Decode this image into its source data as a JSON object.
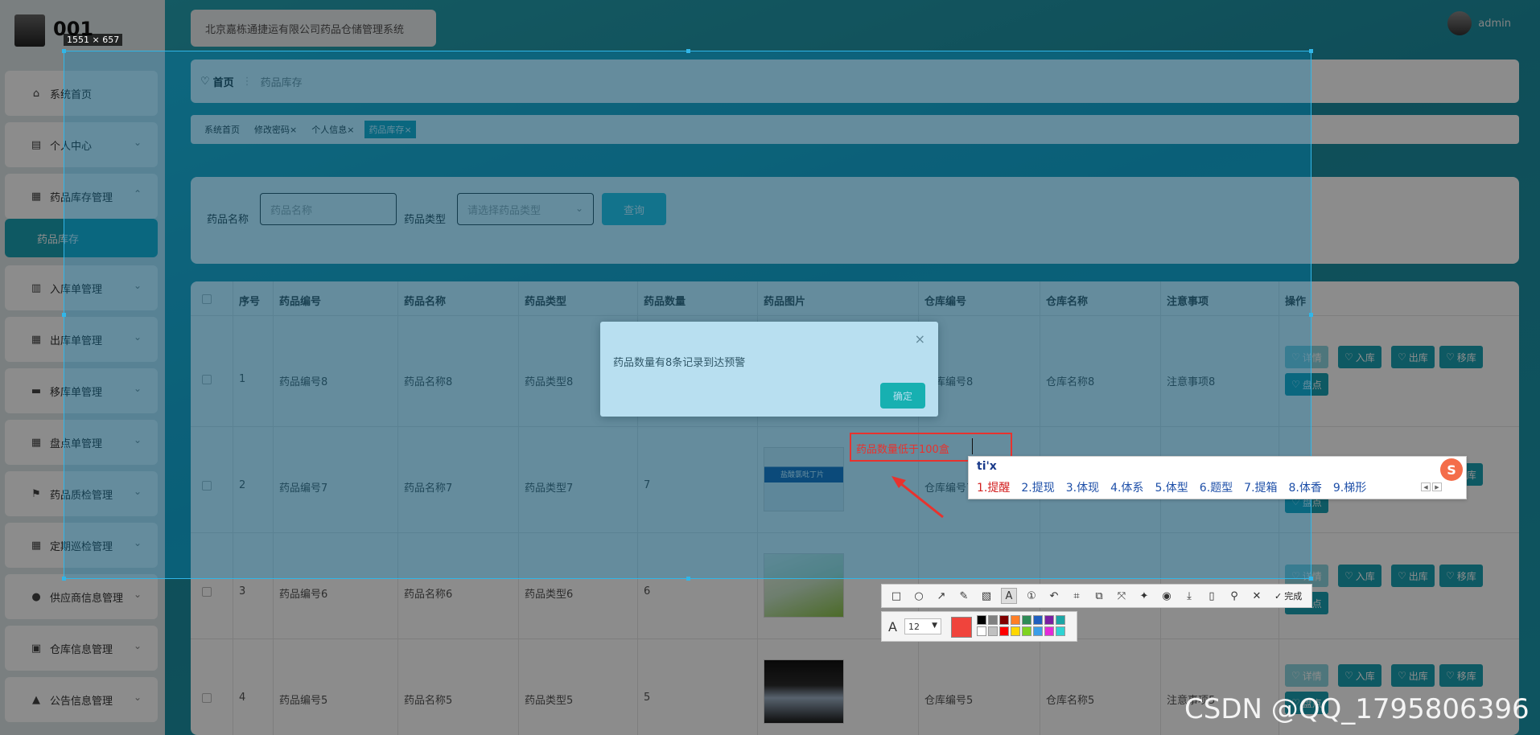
{
  "app": {
    "user_name": "001",
    "system_title": "北京嘉栋通捷运有限公司药品仓储管理系统",
    "top_user_name": "admin"
  },
  "sidebar": {
    "items": [
      {
        "label": "系统首页",
        "icon": "home-icon",
        "glyph": "⌂",
        "chevron": ""
      },
      {
        "label": "个人中心",
        "icon": "calendar-icon",
        "glyph": "▤",
        "chevron": "⌄"
      },
      {
        "label": "药品库存管理",
        "icon": "grid-icon",
        "glyph": "▦",
        "chevron": "⌃"
      },
      {
        "label": "入库单管理",
        "icon": "bar-chart-icon",
        "glyph": "▥",
        "chevron": "⌄"
      },
      {
        "label": "出库单管理",
        "icon": "grid-icon",
        "glyph": "▦",
        "chevron": "⌄"
      },
      {
        "label": "移库单管理",
        "icon": "briefcase-icon",
        "glyph": "▬",
        "chevron": "⌄"
      },
      {
        "label": "盘点单管理",
        "icon": "grid-icon",
        "glyph": "▦",
        "chevron": "⌄"
      },
      {
        "label": "药品质检管理",
        "icon": "flag-icon",
        "glyph": "⚑",
        "chevron": "⌄"
      },
      {
        "label": "定期巡检管理",
        "icon": "grid-icon",
        "glyph": "▦",
        "chevron": "⌄"
      },
      {
        "label": "供应商信息管理",
        "icon": "user-icon",
        "glyph": "●",
        "chevron": "⌄"
      },
      {
        "label": "仓库信息管理",
        "icon": "clipboard-icon",
        "glyph": "▣",
        "chevron": "⌄"
      },
      {
        "label": "公告信息管理",
        "icon": "bell-icon",
        "glyph": "▲",
        "chevron": "⌄"
      }
    ],
    "sub_item": "药品库存"
  },
  "breadcrumb": {
    "home": "首页",
    "current": "药品库存",
    "home_icon": "heart-icon"
  },
  "tabs": [
    {
      "label": "系统首页",
      "close": ""
    },
    {
      "label": "修改密码",
      "close": "×"
    },
    {
      "label": "个人信息",
      "close": "×"
    },
    {
      "label": "药品库存",
      "close": "×",
      "active": true
    }
  ],
  "search": {
    "name_label": "药品名称",
    "name_placeholder": "药品名称",
    "type_label": "药品类型",
    "type_placeholder": "请选择药品类型",
    "query_button": "查询"
  },
  "table": {
    "headers": [
      "序号",
      "药品编号",
      "药品名称",
      "药品类型",
      "药品数量",
      "药品图片",
      "仓库编号",
      "仓库名称",
      "注意事项",
      "操作"
    ],
    "rows": [
      {
        "index": "1",
        "code": "药品编号8",
        "name": "药品名称8",
        "type": "药品类型8",
        "qty": "",
        "warehouse_code": "仓库编号8",
        "warehouse_name": "仓库名称8",
        "note": "注意事项8"
      },
      {
        "index": "2",
        "code": "药品编号7",
        "name": "药品名称7",
        "type": "药品类型7",
        "qty": "7",
        "warehouse_code": "仓库编号7",
        "warehouse_name": "",
        "note": ""
      },
      {
        "index": "3",
        "code": "药品编号6",
        "name": "药品名称6",
        "type": "药品类型6",
        "qty": "6",
        "warehouse_code": "",
        "warehouse_name": "",
        "note": ""
      },
      {
        "index": "4",
        "code": "药品编号5",
        "name": "药品名称5",
        "type": "药品类型5",
        "qty": "5",
        "warehouse_code": "仓库编号5",
        "warehouse_name": "仓库名称5",
        "note": "注意事项5"
      }
    ],
    "op_buttons": [
      "详情",
      "入库",
      "出库",
      "移库",
      "盘点"
    ],
    "thumb_text": "盐酸氯吡丁片"
  },
  "modal": {
    "message": "药品数量有8条记录到达预警",
    "ok_label": "确定",
    "close_glyph": "×"
  },
  "capture": {
    "size_label": "1551 × 657",
    "annotation_text": "药品数量低于100盒",
    "border_color": "#31b6e8",
    "annotation_color": "#e8322e"
  },
  "ime": {
    "composition": "ti'x",
    "candidates": [
      "1.提醒",
      "2.提现",
      "3.体现",
      "4.体系",
      "5.体型",
      "6.题型",
      "7.提箱",
      "8.体香",
      "9.梯形"
    ],
    "logo": "S"
  },
  "toolbar": {
    "tools": [
      {
        "name": "rectangle-tool-icon",
        "glyph": "□"
      },
      {
        "name": "ellipse-tool-icon",
        "glyph": "○"
      },
      {
        "name": "arrow-tool-icon",
        "glyph": "↗"
      },
      {
        "name": "pen-tool-icon",
        "glyph": "✎"
      },
      {
        "name": "mosaic-tool-icon",
        "glyph": "▧"
      },
      {
        "name": "text-tool-icon",
        "glyph": "A",
        "active": true
      },
      {
        "name": "number-tool-icon",
        "glyph": "①"
      },
      {
        "name": "undo-icon",
        "glyph": "↶"
      },
      {
        "name": "ocr-icon",
        "glyph": "⌗"
      },
      {
        "name": "translate-icon",
        "glyph": "⧉"
      },
      {
        "name": "long-capture-icon",
        "glyph": "⤧"
      },
      {
        "name": "pin-icon",
        "glyph": "✦"
      },
      {
        "name": "record-icon",
        "glyph": "◉"
      },
      {
        "name": "download-icon",
        "glyph": "⤓"
      },
      {
        "name": "phone-icon",
        "glyph": "▯"
      },
      {
        "name": "bookmark-icon",
        "glyph": "⚲"
      },
      {
        "name": "cancel-icon",
        "glyph": "✕"
      }
    ],
    "done_label": "完成",
    "font_size": "12",
    "current_color": "#f0443c",
    "palette": [
      "#000000",
      "#808080",
      "#800000",
      "#ff7f27",
      "#2e8b57",
      "#1f5fbf",
      "#7a1fa2",
      "#1ba5a5",
      "#ffffff",
      "#c0c0c0",
      "#ff0000",
      "#ffd700",
      "#7fd321",
      "#3c9ee8",
      "#e22bd9",
      "#2fd3d3"
    ]
  },
  "watermark": "CSDN @QQ_1795806396"
}
